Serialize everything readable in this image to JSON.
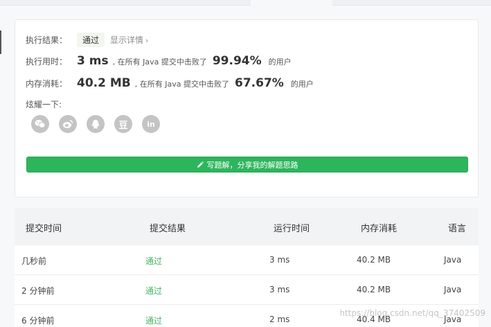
{
  "result": {
    "status_label": "执行结果：",
    "status_badge": "通过",
    "details_link": "显示详情",
    "runtime_label": "执行用时：",
    "runtime_value": "3 ms",
    "runtime_text": ", 在所有 Java 提交中击败了",
    "runtime_pct": "99.94%",
    "runtime_users": "的用户",
    "memory_label": "内存消耗：",
    "memory_value": "40.2 MB",
    "memory_text": ", 在所有 Java 提交中击败了",
    "memory_pct": "67.67%",
    "memory_users": "的用户",
    "share_label": "炫耀一下:",
    "share_icons": [
      "wechat-icon",
      "weibo-icon",
      "qq-icon",
      "douban-icon",
      "linkedin-icon"
    ],
    "douban_glyph": "豆",
    "linkedin_glyph": "in",
    "write_solution_label": "写题解，分享我的解题思路"
  },
  "table": {
    "headers": [
      "提交时间",
      "提交结果",
      "运行时间",
      "内存消耗",
      "语言"
    ],
    "rows": [
      [
        "几秒前",
        "通过",
        "3 ms",
        "40.2 MB",
        "Java"
      ],
      [
        "2 分钟前",
        "通过",
        "3 ms",
        "40.2 MB",
        "Java"
      ],
      [
        "6 分钟前",
        "通过",
        "2 ms",
        "40.4 MB",
        "Java"
      ]
    ]
  },
  "watermark": "https://blog.csdn.net/qq_37402509",
  "colors": {
    "accent_green": "#2db55d",
    "status_green": "#45b35f",
    "icon_gray": "#c4c4c4"
  }
}
